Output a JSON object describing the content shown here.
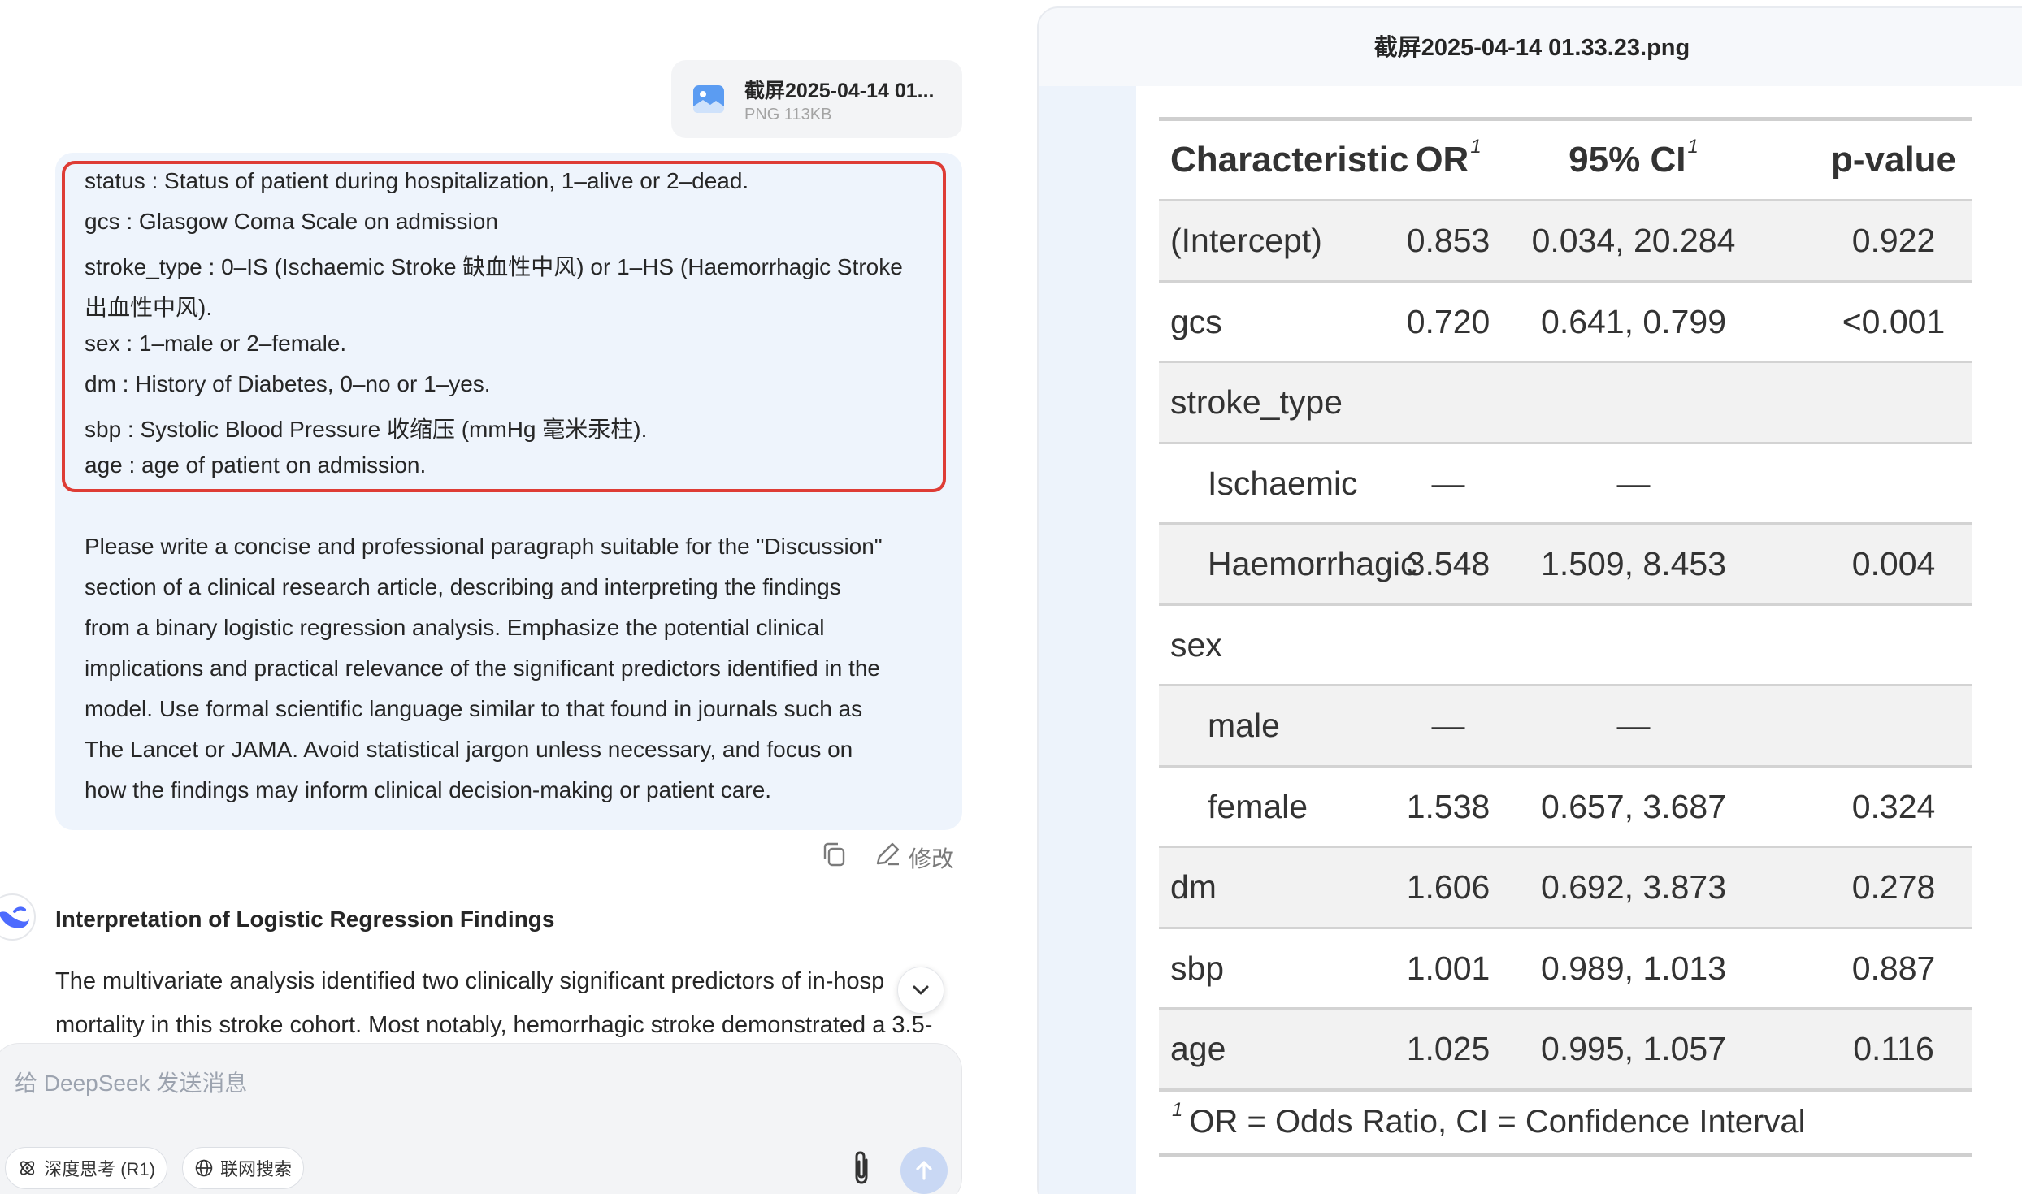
{
  "attachment": {
    "filename": "截屏2025-04-14 01...",
    "meta": "PNG 113KB"
  },
  "user_message": {
    "variable_lines": [
      "status : Status of patient during hospitalization, 1–alive or 2–dead.",
      "gcs : Glasgow Coma Scale on admission",
      "stroke_type : 0–IS (Ischaemic Stroke 缺血性中风) or 1–HS (Haemorrhagic Stroke",
      "出血性中风).",
      "sex : 1–male or 2–female.",
      "dm : History of Diabetes, 0–no or 1–yes.",
      "sbp : Systolic Blood Pressure 收缩压 (mmHg 毫米汞柱).",
      "age : age of patient on admission."
    ],
    "prompt_lines": [
      "Please write a concise and professional paragraph suitable for the \"Discussion\"",
      "section of a clinical research article, describing and interpreting the findings",
      "from a binary logistic regression analysis. Emphasize the potential clinical",
      "implications and practical relevance of the significant predictors identified in the",
      "model. Use formal scientific language similar to that found in journals such as",
      "The Lancet or JAMA. Avoid statistical jargon unless necessary, and focus on",
      "how the findings may inform clinical decision-making or patient care."
    ],
    "edit_label": "修改"
  },
  "assistant": {
    "heading": "Interpretation of Logistic Regression Findings",
    "lines": [
      "The multivariate analysis identified two clinically significant predictors of in-hosp",
      "mortality in this stroke cohort. Most notably, hemorrhagic stroke demonstrated a 3.5-"
    ]
  },
  "composer": {
    "placeholder": "给 DeepSeek 发送消息",
    "deep_think_label": "深度思考 (R1)",
    "web_search_label": "联网搜索"
  },
  "viewer": {
    "title": "截屏2025-04-14 01.33.23.png"
  },
  "table": {
    "headers": [
      "Characteristic",
      "OR",
      "95% CI",
      "p-value"
    ],
    "header_footnote_mark": "1",
    "rows": [
      {
        "label": "(Intercept)",
        "indent": false,
        "or": "0.853",
        "ci": "0.034, 20.284",
        "p": "0.922"
      },
      {
        "label": "gcs",
        "indent": false,
        "or": "0.720",
        "ci": "0.641, 0.799",
        "p": "<0.001"
      },
      {
        "label": "stroke_type",
        "indent": false,
        "or": "",
        "ci": "",
        "p": ""
      },
      {
        "label": "Ischaemic",
        "indent": true,
        "or": "—",
        "ci": "—",
        "p": ""
      },
      {
        "label": "Haemorrhagic",
        "indent": true,
        "or": "3.548",
        "ci": "1.509, 8.453",
        "p": "0.004"
      },
      {
        "label": "sex",
        "indent": false,
        "or": "",
        "ci": "",
        "p": ""
      },
      {
        "label": "male",
        "indent": true,
        "or": "—",
        "ci": "—",
        "p": ""
      },
      {
        "label": "female",
        "indent": true,
        "or": "1.538",
        "ci": "0.657, 3.687",
        "p": "0.324"
      },
      {
        "label": "dm",
        "indent": false,
        "or": "1.606",
        "ci": "0.692, 3.873",
        "p": "0.278"
      },
      {
        "label": "sbp",
        "indent": false,
        "or": "1.001",
        "ci": "0.989, 1.013",
        "p": "0.887"
      },
      {
        "label": "age",
        "indent": false,
        "or": "1.025",
        "ci": "0.995, 1.057",
        "p": "0.116"
      }
    ],
    "footnote_mark": "1",
    "footnote": "OR = Odds Ratio, CI = Confidence Interval"
  },
  "colors": {
    "highlight_border": "#de3c35",
    "user_bubble": "#eef4fc",
    "send_button": "#c9d8f4",
    "table_shade": "#f2f2f2"
  }
}
